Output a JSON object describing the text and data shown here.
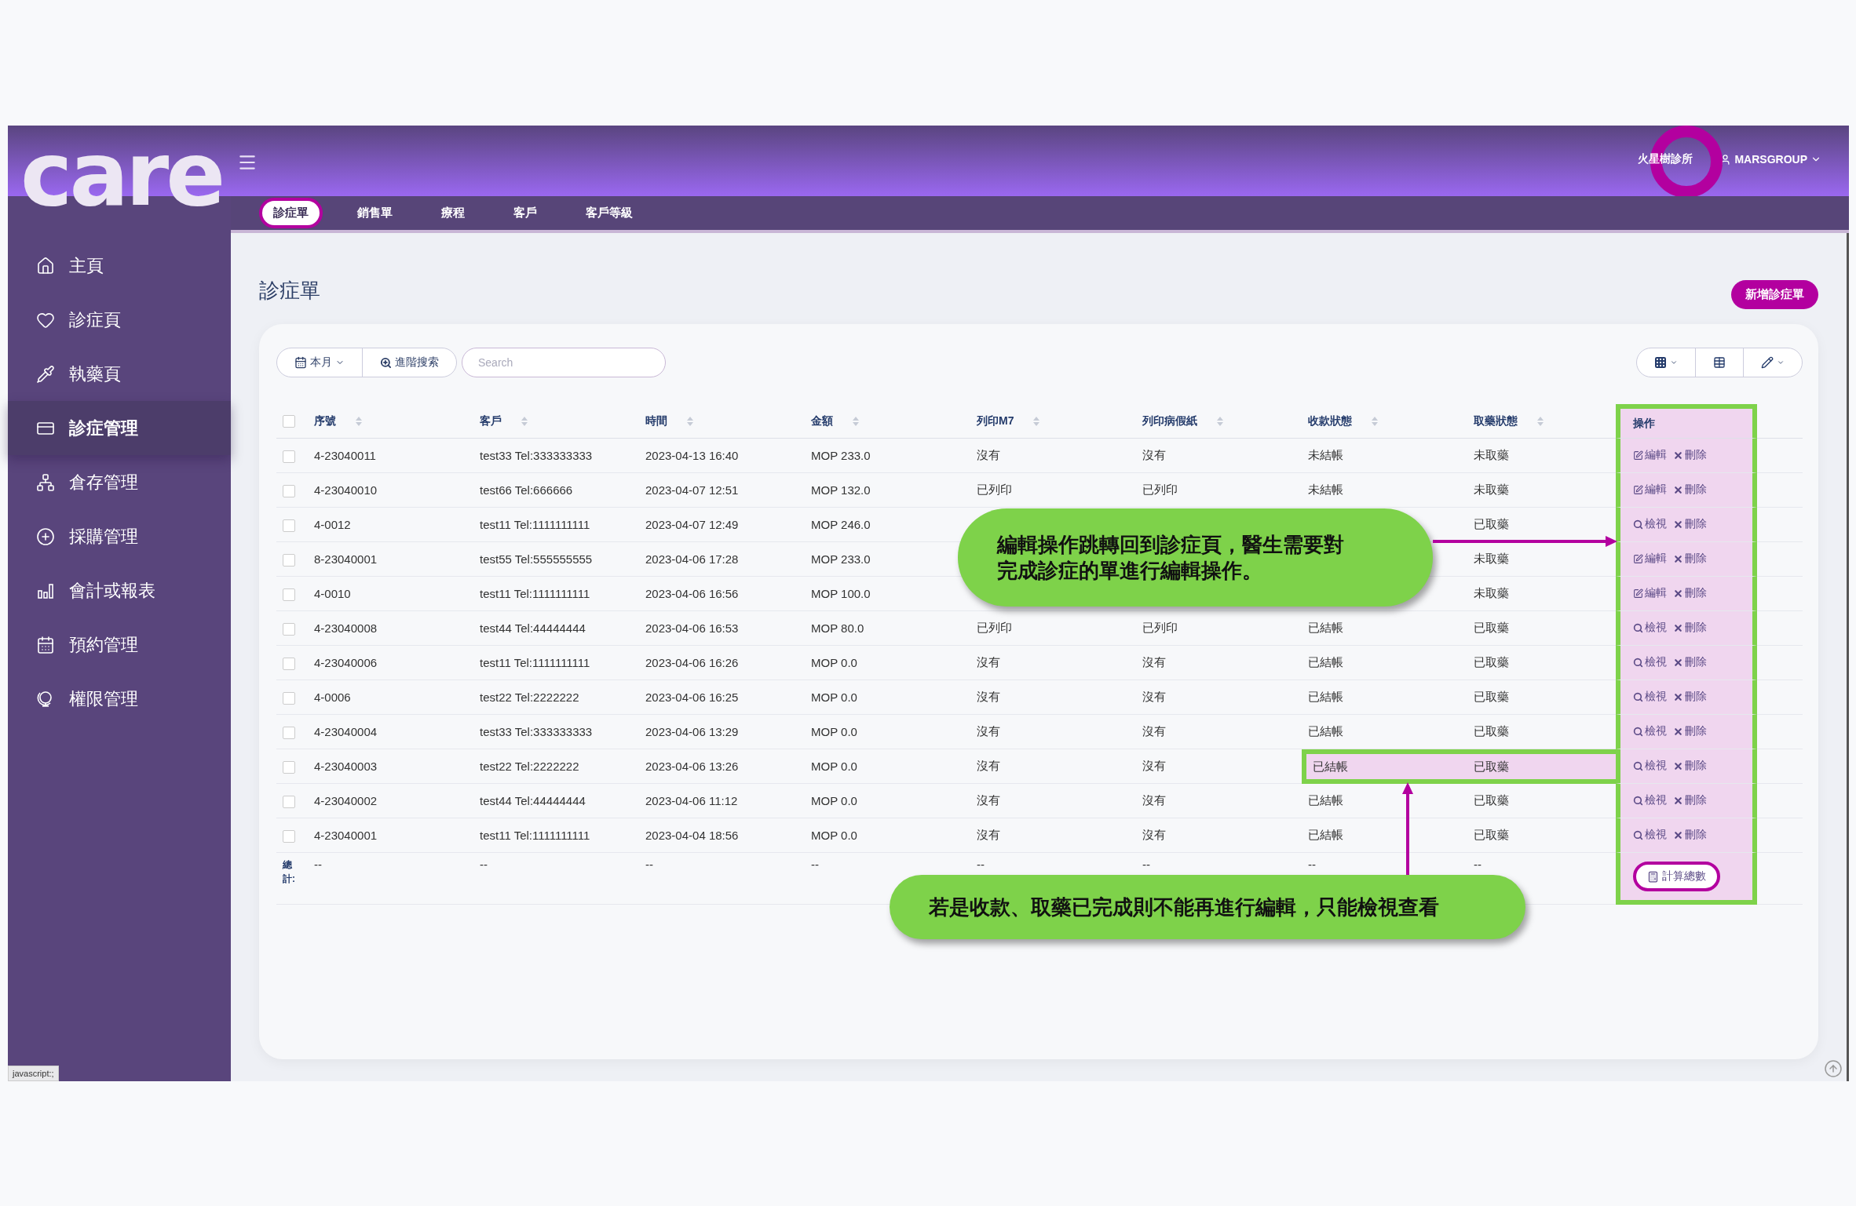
{
  "header": {
    "logo": "care",
    "clinic": "火星樹診所",
    "user": "MARSGROUP"
  },
  "sidebar": {
    "items": [
      {
        "label": "主頁",
        "selected": false
      },
      {
        "label": "診症頁",
        "selected": false
      },
      {
        "label": "執藥頁",
        "selected": false
      },
      {
        "label": "診症管理",
        "selected": true
      },
      {
        "label": "倉存管理",
        "selected": false
      },
      {
        "label": "採購管理",
        "selected": false
      },
      {
        "label": "會計或報表",
        "selected": false
      },
      {
        "label": "預約管理",
        "selected": false
      },
      {
        "label": "權限管理",
        "selected": false
      }
    ],
    "status_text": "javascript:;"
  },
  "tabs": [
    {
      "label": "診症單",
      "selected": true
    },
    {
      "label": "銷售單",
      "selected": false
    },
    {
      "label": "療程",
      "selected": false
    },
    {
      "label": "客戶",
      "selected": false
    },
    {
      "label": "客戶等級",
      "selected": false
    }
  ],
  "page": {
    "title": "診症單",
    "add_button": "新增診症單"
  },
  "toolbar": {
    "period": "本月",
    "advanced_search": "進階搜索",
    "search": {
      "placeholder": "Search"
    }
  },
  "table": {
    "select_all": {
      "checked": false
    },
    "columns": [
      {
        "label": "序號",
        "sortable": true
      },
      {
        "label": "客戶",
        "sortable": true
      },
      {
        "label": "時間",
        "sortable": true
      },
      {
        "label": "金額",
        "sortable": true
      },
      {
        "label": "列印M7",
        "sortable": true
      },
      {
        "label": "列印病假紙",
        "sortable": true
      },
      {
        "label": "收款狀態",
        "sortable": true
      },
      {
        "label": "取藥狀態",
        "sortable": true
      },
      {
        "label": "操作",
        "sortable": false,
        "highlighted": true
      }
    ],
    "rows": [
      {
        "checked": false,
        "no": "4-23040011",
        "customer": "test33 Tel:333333333",
        "time": "2023-04-13 16:40",
        "amount": "MOP 233.0",
        "print_m7": "沒有",
        "print_sick_note": "沒有",
        "payment_status": "未結帳",
        "pickup_status": "未取藥",
        "actions": [
          {
            "kind": "edit",
            "label": "編輯"
          },
          {
            "kind": "delete",
            "label": "刪除"
          }
        ]
      },
      {
        "checked": false,
        "no": "4-23040010",
        "customer": "test66 Tel:666666",
        "time": "2023-04-07 12:51",
        "amount": "MOP 132.0",
        "print_m7": "已列印",
        "print_sick_note": "已列印",
        "payment_status": "未結帳",
        "pickup_status": "未取藥",
        "actions": [
          {
            "kind": "edit",
            "label": "編輯"
          },
          {
            "kind": "delete",
            "label": "刪除"
          }
        ]
      },
      {
        "checked": false,
        "no": "4-0012",
        "customer": "test11 Tel:1111111111",
        "time": "2023-04-07 12:49",
        "amount": "MOP 246.0",
        "pickup_status": "已取藥",
        "actions": [
          {
            "kind": "view",
            "label": "檢視"
          },
          {
            "kind": "delete",
            "label": "刪除"
          }
        ]
      },
      {
        "checked": false,
        "no": "8-23040001",
        "customer": "test55 Tel:555555555",
        "time": "2023-04-06 17:28",
        "amount": "MOP 233.0",
        "pickup_status": "未取藥",
        "actions": [
          {
            "kind": "edit",
            "label": "編輯"
          },
          {
            "kind": "delete",
            "label": "刪除"
          }
        ]
      },
      {
        "checked": false,
        "no": "4-0010",
        "customer": "test11 Tel:1111111111",
        "time": "2023-04-06 16:56",
        "amount": "MOP 100.0",
        "pickup_status": "未取藥",
        "actions": [
          {
            "kind": "edit",
            "label": "編輯"
          },
          {
            "kind": "delete",
            "label": "刪除"
          }
        ]
      },
      {
        "checked": false,
        "no": "4-23040008",
        "customer": "test44 Tel:44444444",
        "time": "2023-04-06 16:53",
        "amount": "MOP 80.0",
        "print_m7": "已列印",
        "print_sick_note": "已列印",
        "payment_status": "已結帳",
        "pickup_status": "已取藥",
        "actions": [
          {
            "kind": "view",
            "label": "檢視"
          },
          {
            "kind": "delete",
            "label": "刪除"
          }
        ]
      },
      {
        "checked": false,
        "no": "4-23040006",
        "customer": "test11 Tel:1111111111",
        "time": "2023-04-06 16:26",
        "amount": "MOP 0.0",
        "print_m7": "沒有",
        "print_sick_note": "沒有",
        "payment_status": "已結帳",
        "pickup_status": "已取藥",
        "actions": [
          {
            "kind": "view",
            "label": "檢視"
          },
          {
            "kind": "delete",
            "label": "刪除"
          }
        ]
      },
      {
        "checked": false,
        "no": "4-0006",
        "customer": "test22 Tel:2222222",
        "time": "2023-04-06 16:25",
        "amount": "MOP 0.0",
        "print_m7": "沒有",
        "print_sick_note": "沒有",
        "payment_status": "已結帳",
        "pickup_status": "已取藥",
        "actions": [
          {
            "kind": "view",
            "label": "檢視"
          },
          {
            "kind": "delete",
            "label": "刪除"
          }
        ]
      },
      {
        "checked": false,
        "no": "4-23040004",
        "customer": "test33 Tel:333333333",
        "time": "2023-04-06 13:29",
        "amount": "MOP 0.0",
        "print_m7": "沒有",
        "print_sick_note": "沒有",
        "payment_status": "已結帳",
        "pickup_status": "已取藥",
        "actions": [
          {
            "kind": "view",
            "label": "檢視"
          },
          {
            "kind": "delete",
            "label": "刪除"
          }
        ]
      },
      {
        "checked": false,
        "no": "4-23040003",
        "customer": "test22 Tel:2222222",
        "time": "2023-04-06 13:26",
        "amount": "MOP 0.0",
        "print_m7": "沒有",
        "print_sick_note": "沒有",
        "payment_status": "已結帳",
        "pickup_status": "已取藥",
        "highlight": {
          "payment_status": true,
          "pickup_status": true
        },
        "actions": [
          {
            "kind": "view",
            "label": "檢視"
          },
          {
            "kind": "delete",
            "label": "刪除"
          }
        ]
      },
      {
        "checked": false,
        "no": "4-23040002",
        "customer": "test44 Tel:44444444",
        "time": "2023-04-06 11:12",
        "amount": "MOP 0.0",
        "print_m7": "沒有",
        "print_sick_note": "沒有",
        "payment_status": "已結帳",
        "pickup_status": "已取藥",
        "actions": [
          {
            "kind": "view",
            "label": "檢視"
          },
          {
            "kind": "delete",
            "label": "刪除"
          }
        ]
      },
      {
        "checked": false,
        "no": "4-23040001",
        "customer": "test11 Tel:1111111111",
        "time": "2023-04-04 18:56",
        "amount": "MOP 0.0",
        "print_m7": "沒有",
        "print_sick_note": "沒有",
        "payment_status": "已結帳",
        "pickup_status": "已取藥",
        "actions": [
          {
            "kind": "view",
            "label": "檢視"
          },
          {
            "kind": "delete",
            "label": "刪除"
          }
        ]
      }
    ],
    "totals": {
      "label": "總計:",
      "values": [
        "--",
        "--",
        "--",
        "--",
        "--",
        "--",
        "--",
        "--"
      ],
      "button": "計算總數"
    }
  },
  "annotations": [
    {
      "text": "編輯操作跳轉回到診症頁，醫生需要對完成診症的單進行編輯操作。"
    },
    {
      "text": "若是收款、取藥已完成則不能再進行編輯，只能檢視查看"
    }
  ]
}
